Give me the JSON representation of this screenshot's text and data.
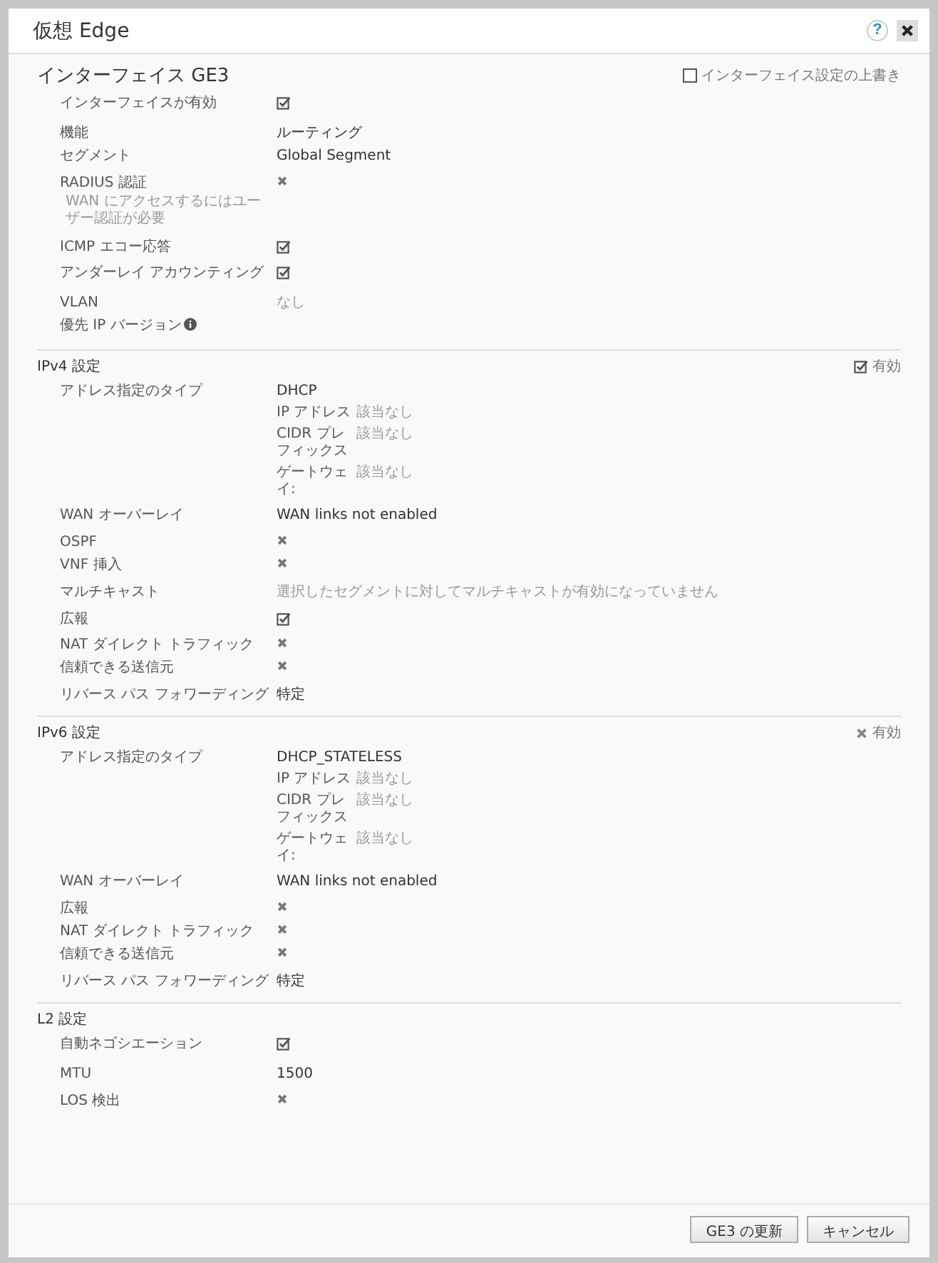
{
  "window": {
    "title": "仮想 Edge",
    "help": "?"
  },
  "sections": [
    {
      "title": "インターフェイス GE3",
      "toggle": {
        "label": "インターフェイス設定の上書き",
        "kind": "box",
        "checked": false
      },
      "rows": [
        {
          "label": "インターフェイスが有効",
          "kind": "check",
          "checked": true
        },
        {
          "label": "機能",
          "kind": "text",
          "value": "ルーティング",
          "muted": false
        },
        {
          "label": "セグメント",
          "kind": "text",
          "value": "Global Segment",
          "muted": false
        },
        {
          "label": "RADIUS 認証",
          "note": "WAN にアクセスするにはユーザー認証が必要",
          "kind": "check",
          "checked": false
        },
        {
          "label": "ICMP エコー応答",
          "kind": "check",
          "checked": true
        },
        {
          "label": "アンダーレイ アカウンティング",
          "kind": "check",
          "checked": true
        },
        {
          "label": "VLAN",
          "kind": "text",
          "value": "なし",
          "muted": true
        },
        {
          "label": "優先 IP バージョン",
          "kind": "info"
        }
      ]
    },
    {
      "title": "IPv4 設定",
      "toggle": {
        "label": "有効",
        "kind": "mark",
        "checked": true
      },
      "rows": [
        {
          "label": "アドレス指定のタイプ",
          "kind": "address",
          "value": "DHCP",
          "sub": [
            {
              "label": "IP アドレス",
              "value": "該当なし"
            },
            {
              "label": "CIDR プレフィックス",
              "value": "該当なし"
            },
            {
              "label": "ゲートウェイ:",
              "value": "該当なし"
            }
          ]
        },
        {
          "label": "WAN オーバーレイ",
          "kind": "text",
          "value": "WAN links not enabled",
          "muted": false
        },
        {
          "label": "OSPF",
          "kind": "check",
          "checked": false
        },
        {
          "label": "VNF 挿入",
          "kind": "check",
          "checked": false
        },
        {
          "label": "マルチキャスト",
          "kind": "text",
          "value": "選択したセグメントに対してマルチキャストが有効になっていません",
          "muted": true
        },
        {
          "label": "広報",
          "kind": "check",
          "checked": true
        },
        {
          "label": "NAT ダイレクト トラフィック",
          "kind": "check",
          "checked": false
        },
        {
          "label": "信頼できる送信元",
          "kind": "check",
          "checked": false
        },
        {
          "label": "リバース パス フォワーディング",
          "kind": "text",
          "value": "特定",
          "muted": false
        }
      ]
    },
    {
      "title": "IPv6 設定",
      "toggle": {
        "label": "有効",
        "kind": "mark",
        "checked": false
      },
      "rows": [
        {
          "label": "アドレス指定のタイプ",
          "kind": "address",
          "value": "DHCP_STATELESS",
          "sub": [
            {
              "label": "IP アドレス",
              "value": "該当なし"
            },
            {
              "label": "CIDR プレフィックス",
              "value": "該当なし"
            },
            {
              "label": "ゲートウェイ:",
              "value": "該当なし"
            }
          ]
        },
        {
          "label": "WAN オーバーレイ",
          "kind": "text",
          "value": "WAN links not enabled",
          "muted": false
        },
        {
          "label": "広報",
          "kind": "check",
          "checked": false
        },
        {
          "label": "NAT ダイレクト トラフィック",
          "kind": "check",
          "checked": false
        },
        {
          "label": "信頼できる送信元",
          "kind": "check",
          "checked": false
        },
        {
          "label": "リバース パス フォワーディング",
          "kind": "text",
          "value": "特定",
          "muted": false
        }
      ]
    },
    {
      "title": "L2 設定",
      "rows": [
        {
          "label": "自動ネゴシエーション",
          "kind": "check",
          "checked": true
        },
        {
          "label": "MTU",
          "kind": "text",
          "value": "1500",
          "muted": false
        },
        {
          "label": "LOS 検出",
          "kind": "check",
          "checked": false
        }
      ]
    }
  ],
  "buttons": [
    "GE3 の更新",
    "キャンセル"
  ]
}
